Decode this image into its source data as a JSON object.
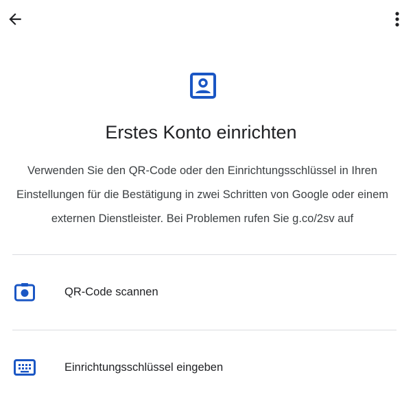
{
  "toolbar": {
    "back_icon": "arrow-back-icon",
    "more_icon": "more-vert-icon"
  },
  "hero": {
    "icon": "account-box-icon",
    "icon_color": "#1a56c4"
  },
  "title": "Erstes Konto einrichten",
  "description": "Verwenden Sie den QR-Code oder den Einrichtungsschlüssel in Ihren Einstellungen für die Bestätigung in zwei Schritten von Google oder einem externen Dienstleister. Bei Problemen rufen Sie g.co/2sv auf",
  "options": [
    {
      "label": "QR-Code scannen",
      "icon": "camera-icon"
    },
    {
      "label": "Einrichtungsschlüssel eingeben",
      "icon": "keyboard-icon"
    }
  ],
  "colors": {
    "accent": "#1a56c4",
    "text_primary": "#202124",
    "divider": "#dadce0"
  }
}
